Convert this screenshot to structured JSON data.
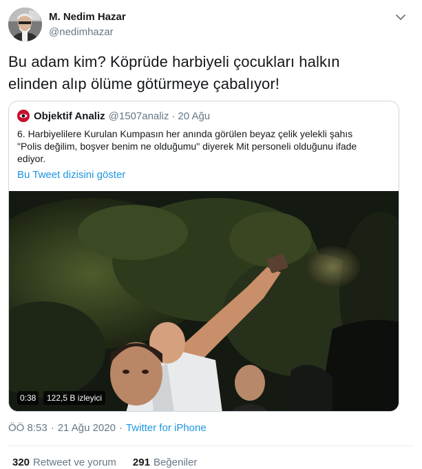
{
  "author": {
    "name": "M. Nedim Hazar",
    "handle": "@nedimhazar"
  },
  "tweet": {
    "text_line1": "Bu adam kim? Köprüde harbiyeli çocukları halkın",
    "text_line2": "elinden alıp ölüme götürmeye çabalıyor!"
  },
  "quoted": {
    "name": "Objektif Analiz",
    "handle": "@1507analiz",
    "separator": "·",
    "date": "20 Ağu",
    "text_line1": "6. Harbiyelilere Kurulan Kumpasın her anında görülen beyaz çelik yelekli şahıs",
    "text_line2": "\"Polis değilim, boşver benim ne olduğumu\" diyerek Mit personeli olduğunu ifade",
    "text_line3": "ediyor.",
    "thread_link": "Bu Tweet dizisini göster",
    "video": {
      "duration": "0:38",
      "views": "122,5 B izleyici"
    }
  },
  "meta": {
    "time": "ÖÖ 8:53",
    "separator1": "·",
    "date": "21 Ağu 2020",
    "separator2": "·",
    "source": "Twitter for iPhone"
  },
  "stats": {
    "retweets_count": "320",
    "retweets_label": "Retweet ve yorum",
    "likes_count": "291",
    "likes_label": "Beğeniler"
  },
  "colors": {
    "link": "#1b95e0",
    "muted": "#657786",
    "text": "#14171a",
    "border": "#ccd6dd"
  },
  "icons": {
    "caret": "chevron-down-icon",
    "quoted_avatar": "objektif-analiz-logo"
  }
}
